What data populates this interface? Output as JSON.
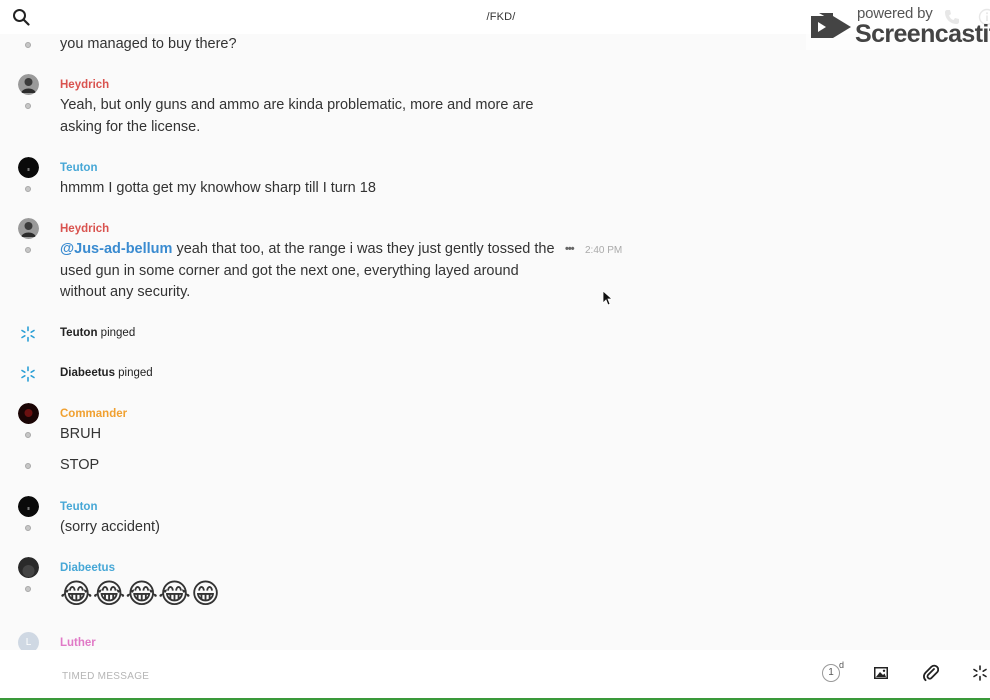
{
  "header": {
    "channel_title": "/FKD/",
    "watermark_small": "powered by",
    "watermark_big": "Screencastify"
  },
  "colors": {
    "heydrich": "#d9534f",
    "teuton": "#46a7d6",
    "diabeetus": "#46a7d6",
    "commander": "#f0a030",
    "luther": "#e079c6",
    "mention": "#3a8bd0",
    "ping": "#2a9fd6"
  },
  "messages": {
    "m0": {
      "text": "you managed to buy there?"
    },
    "m1": {
      "author": "Heydrich",
      "text": "Yeah, but only guns and ammo are kinda problematic, more and more are asking for the license."
    },
    "m2": {
      "author": "Teuton",
      "text": "hmmm I gotta get my knowhow sharp till I turn 18"
    },
    "m3": {
      "author": "Heydrich",
      "mention": "@Jus-ad-bellum",
      "text": " yeah that too, at the range i was they just gently tossed the used gun in some corner and got the next one, everything layed around without any security.",
      "time": "2:40 PM"
    },
    "p1": {
      "name": "Teuton",
      "action": " pinged"
    },
    "p2": {
      "name": "Diabeetus",
      "action": " pinged"
    },
    "m4": {
      "author": "Commander",
      "text": "BRUH"
    },
    "m5": {
      "text": "STOP"
    },
    "m6": {
      "author": "Teuton",
      "text": "(sorry accident)"
    },
    "m7": {
      "author": "Diabeetus",
      "emoji": "😂😂😂😂😁"
    },
    "m8": {
      "author": "Luther",
      "initial": "L"
    }
  },
  "composer": {
    "placeholder": "TIMED MESSAGE",
    "timer_value": "1",
    "timer_unit": "d"
  },
  "icons": [
    "search-icon",
    "phone-icon",
    "info-icon",
    "ping-icon",
    "more-icon",
    "image-icon",
    "paperclip-icon",
    "timer-icon"
  ]
}
